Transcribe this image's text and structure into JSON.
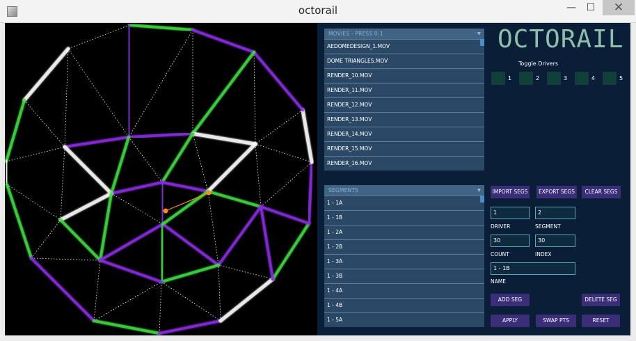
{
  "window": {
    "title": "octorail",
    "minimize": "—",
    "maximize": "☐",
    "close": "✕"
  },
  "logo": "OCTORAIL",
  "movies": {
    "header": "MOVIES - PRESS 0-1",
    "items": [
      "AEDOMEDESIGN_1.MOV",
      "DOME TRIANGLES.MOV",
      "RENDER_10.MOV",
      "RENDER_11.MOV",
      "RENDER_12.MOV",
      "RENDER_13.MOV",
      "RENDER_14.MOV",
      "RENDER_15.MOV",
      "RENDER_16.MOV"
    ]
  },
  "segments": {
    "header": "SEGMENTS",
    "items": [
      "1 - 1A",
      "1 - 1B",
      "1 - 2A",
      "1 - 2B",
      "1 - 3A",
      "1 - 3B",
      "1 - 4A",
      "1 - 4B",
      "1 - 5A"
    ]
  },
  "toggle": {
    "label": "Toggle Drivers",
    "numbers": [
      "1",
      "2",
      "3",
      "4",
      "5"
    ]
  },
  "buttons": {
    "import": "IMPORT SEGS",
    "export": "EXPORT SEGS",
    "clear": "CLEAR SEGS",
    "add": "ADD SEG",
    "delete": "DELETE SEG",
    "apply": "APPLY",
    "swap": "SWAP PTS",
    "reset": "RESET"
  },
  "fields": {
    "driver": {
      "value": "1",
      "label": "DRIVER"
    },
    "segment": {
      "value": "2",
      "label": "SEGMENT"
    },
    "count": {
      "value": "30",
      "label": "COUNT"
    },
    "index": {
      "value": "30",
      "label": "INDEX"
    },
    "name": {
      "value": "1 - 1B",
      "label": "NAME"
    }
  },
  "colors": {
    "purple": "#8a2be2",
    "green": "#3ddc3d",
    "white": "#ffffff",
    "selected": "#ff8c1a"
  }
}
